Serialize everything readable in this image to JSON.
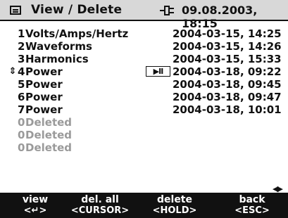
{
  "header": {
    "menu_icon": "menu-icon",
    "title": "View / Delete",
    "power_icon": "plug-icon",
    "datetime": "09.08.2003, 18:15"
  },
  "recordings": [
    {
      "num": "1",
      "name": "Volts/Amps/Hertz",
      "date": "2004-03-15, 14:25",
      "deleted": false,
      "selected": false
    },
    {
      "num": "2",
      "name": "Waveforms",
      "date": "2004-03-15, 14:26",
      "deleted": false,
      "selected": false
    },
    {
      "num": "3",
      "name": "Harmonics",
      "date": "2004-03-15, 15:33",
      "deleted": false,
      "selected": false
    },
    {
      "num": "4",
      "name": "Power",
      "date": "2004-03-18, 09:22",
      "deleted": false,
      "selected": true
    },
    {
      "num": "5",
      "name": "Power",
      "date": "2004-03-18, 09:45",
      "deleted": false,
      "selected": false
    },
    {
      "num": "6",
      "name": "Power",
      "date": "2004-03-18, 09:47",
      "deleted": false,
      "selected": false
    },
    {
      "num": "7",
      "name": "Power",
      "date": "2004-03-18, 10:01",
      "deleted": false,
      "selected": false
    },
    {
      "num": "0",
      "name": "Deleted",
      "date": "",
      "deleted": true,
      "selected": false
    },
    {
      "num": "0",
      "name": "Deleted",
      "date": "",
      "deleted": true,
      "selected": false
    },
    {
      "num": "0",
      "name": "Deleted",
      "date": "",
      "deleted": true,
      "selected": false
    }
  ],
  "cursor_marker": "⇕",
  "play_pause": "▶II",
  "nav_arrows": "◀▶",
  "softkeys": [
    {
      "label": "view",
      "key": "<↵>"
    },
    {
      "label": "del. all",
      "key": "<CURSOR>"
    },
    {
      "label": "delete",
      "key": "<HOLD>"
    },
    {
      "label": "back",
      "key": "<ESC>"
    }
  ],
  "colors": {
    "header_bg": "#d8d8d8",
    "softkey_bg": "#111111",
    "deleted_text": "#9a9a9a"
  }
}
